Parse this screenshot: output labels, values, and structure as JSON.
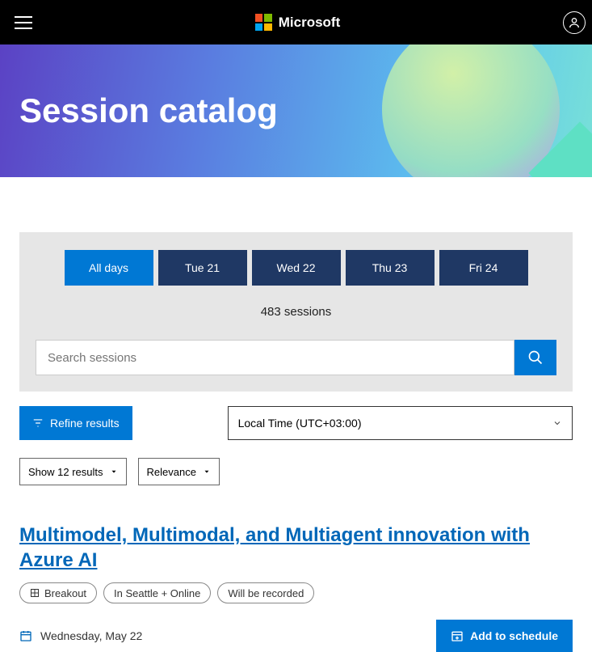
{
  "header": {
    "brand": "Microsoft"
  },
  "hero": {
    "title": "Session catalog"
  },
  "days": {
    "tabs": [
      {
        "label": "All days",
        "active": true
      },
      {
        "label": "Tue 21",
        "active": false
      },
      {
        "label": "Wed 22",
        "active": false
      },
      {
        "label": "Thu 23",
        "active": false
      },
      {
        "label": "Fri 24",
        "active": false
      }
    ],
    "count_text": "483 sessions"
  },
  "search": {
    "placeholder": "Search sessions"
  },
  "controls": {
    "refine_label": "Refine results",
    "timezone": "Local Time (UTC+03:00)",
    "page_size": "Show 12 results",
    "sort": "Relevance"
  },
  "session": {
    "title": "Multimodel, Multimodal, and Multiagent innovation with Azure AI",
    "tags": [
      {
        "label": "Breakout",
        "icon": "grid"
      },
      {
        "label": "In Seattle + Online"
      },
      {
        "label": "Will be recorded"
      }
    ],
    "date": "Wednesday, May 22",
    "add_label": "Add to schedule"
  }
}
